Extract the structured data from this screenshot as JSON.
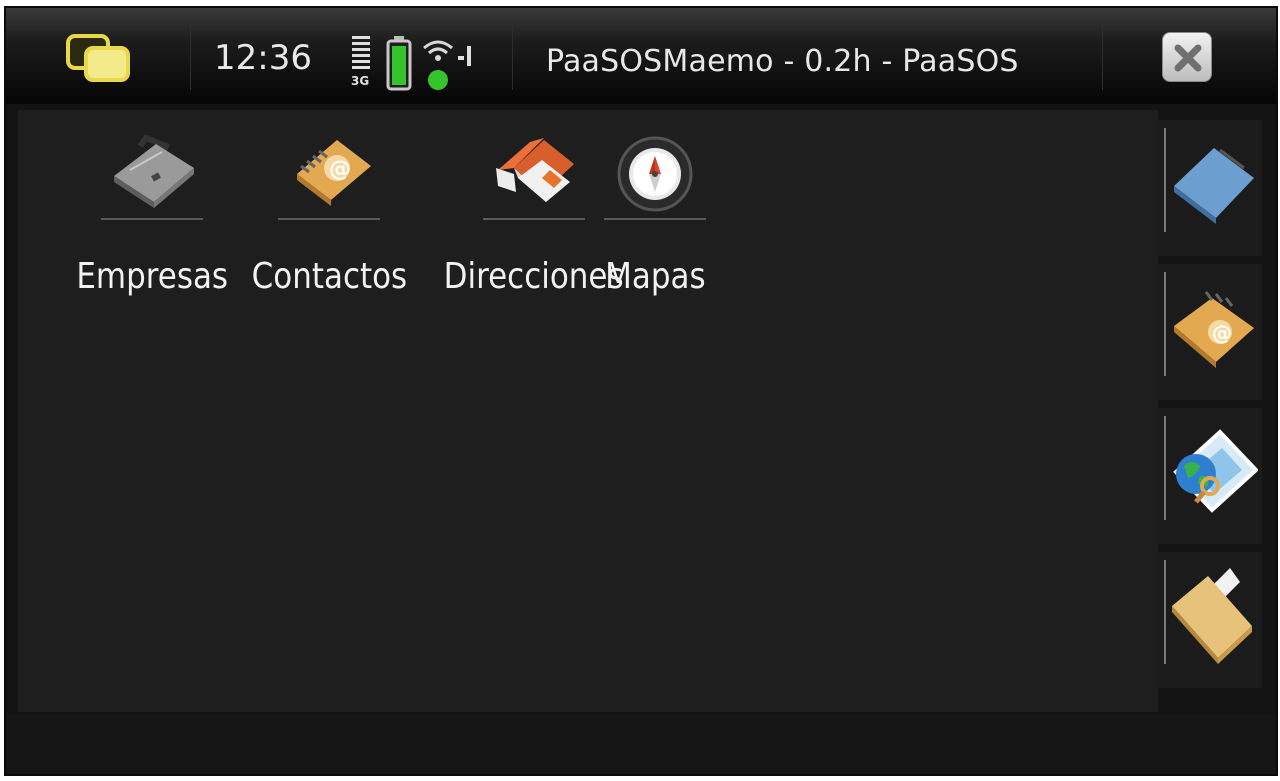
{
  "statusbar": {
    "time": "12:36",
    "network": "3G",
    "title": "PaaSOSMaemo - 0.2h - PaaSOS",
    "icons": [
      "task-switcher-icon",
      "signal-icon",
      "battery-icon",
      "wifi-icon",
      "close-icon"
    ]
  },
  "apps": [
    {
      "label": "Empresas",
      "icon": "briefcase-icon"
    },
    {
      "label": "Contactos",
      "icon": "address-book-icon"
    },
    {
      "label": "Direcciones",
      "icon": "home-icon"
    },
    {
      "label": "Mapas",
      "icon": "compass-icon"
    }
  ],
  "toolbar": [
    "notebook-icon",
    "address-book-icon",
    "web-map-icon",
    "folder-icon"
  ],
  "colors": {
    "background": "#1e1e1e",
    "statusbar": "#050505",
    "text": "#f2f2f2",
    "accent_yellow": "#e8d84a",
    "battery_green": "#35c42b"
  }
}
